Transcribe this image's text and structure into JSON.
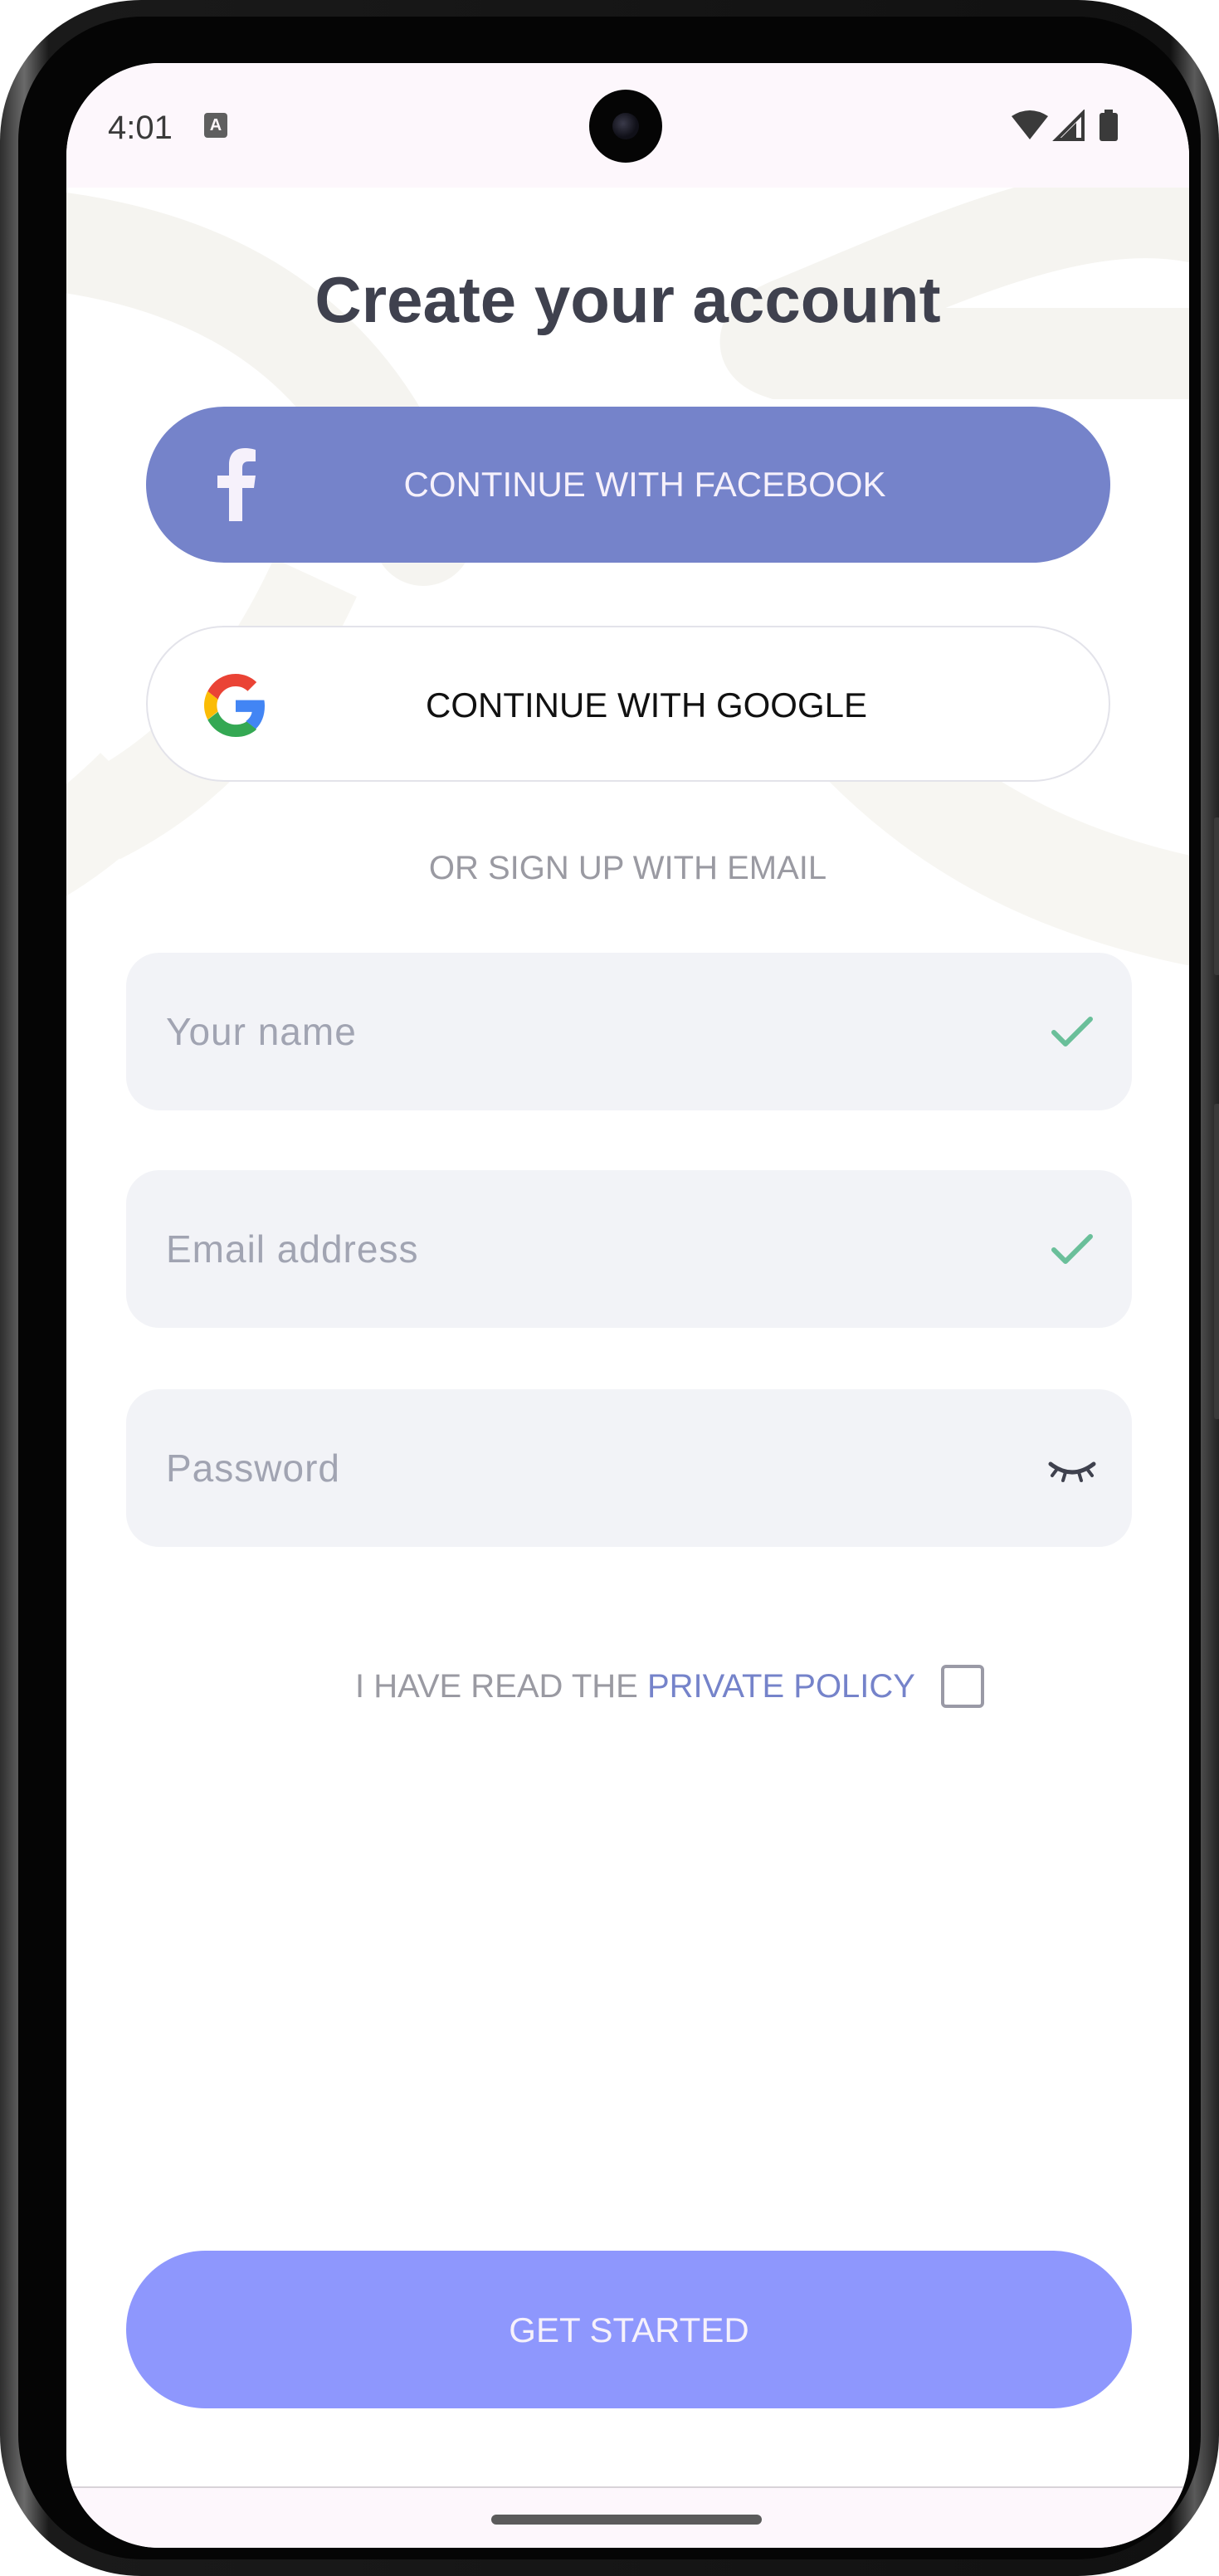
{
  "status_bar": {
    "time": "4:01",
    "notification_icon": "a-badge-icon",
    "icons": [
      "wifi-icon",
      "signal-icon",
      "battery-icon"
    ]
  },
  "screen": {
    "title": "Create your account",
    "facebook_button": {
      "label": "CONTINUE WITH FACEBOOK",
      "icon": "facebook-icon",
      "color": "#7583ca"
    },
    "google_button": {
      "label": "CONTINUE WITH GOOGLE",
      "icon": "google-icon"
    },
    "divider_text": "OR SIGN UP WITH EMAIL",
    "fields": {
      "name": {
        "placeholder": "Your name",
        "value": "",
        "status_icon": "check-icon"
      },
      "email": {
        "placeholder": "Email address",
        "value": "",
        "status_icon": "check-icon"
      },
      "password": {
        "placeholder": "Password",
        "value": "",
        "status_icon": "eye-closed-icon"
      }
    },
    "policy": {
      "prefix": "I HAVE READ THE ",
      "link_text": "PRIVATE POLICY",
      "checked": false
    },
    "primary_button": {
      "label": "GET STARTED",
      "color": "#8e97fd"
    }
  },
  "colors": {
    "title": "#3f414e",
    "field_bg": "#f2f3f7",
    "check": "#6abf9a",
    "link": "#7583ca"
  }
}
